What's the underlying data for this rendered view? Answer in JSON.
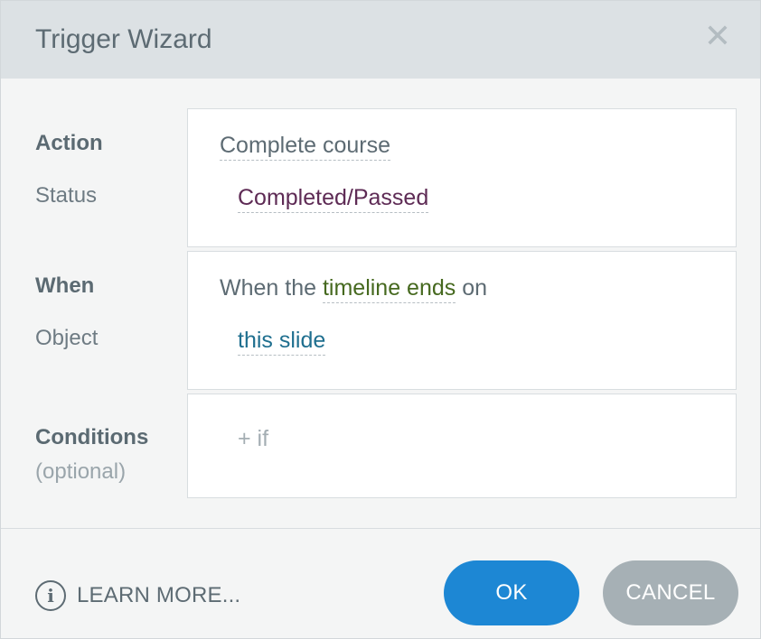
{
  "dialog": {
    "title": "Trigger Wizard",
    "close_glyph": "✕"
  },
  "action_section": {
    "label": "Action",
    "sub_label": "Status",
    "action_value": "Complete course",
    "status_value": "Completed/Passed"
  },
  "when_section": {
    "label": "When",
    "sub_label": "Object",
    "sentence_prefix": "When the",
    "event_value": "timeline ends",
    "sentence_suffix": "on",
    "object_value": "this slide"
  },
  "conditions_section": {
    "label": "Conditions",
    "sub_label": "(optional)",
    "add_condition": "+ if"
  },
  "footer": {
    "info_glyph": "i",
    "learn_more": "LEARN MORE...",
    "ok_label": "OK",
    "cancel_label": "CANCEL"
  },
  "colors": {
    "primary_button": "#1d87d4",
    "secondary_button": "#a6b0b5",
    "titlebar": "#dce1e4",
    "action_value": "#5d6b73",
    "status_value": "#5e2b55",
    "event_value": "#46691f",
    "object_value": "#1f6f8f"
  },
  "icons": {
    "close": "close-icon",
    "info": "info-icon"
  }
}
